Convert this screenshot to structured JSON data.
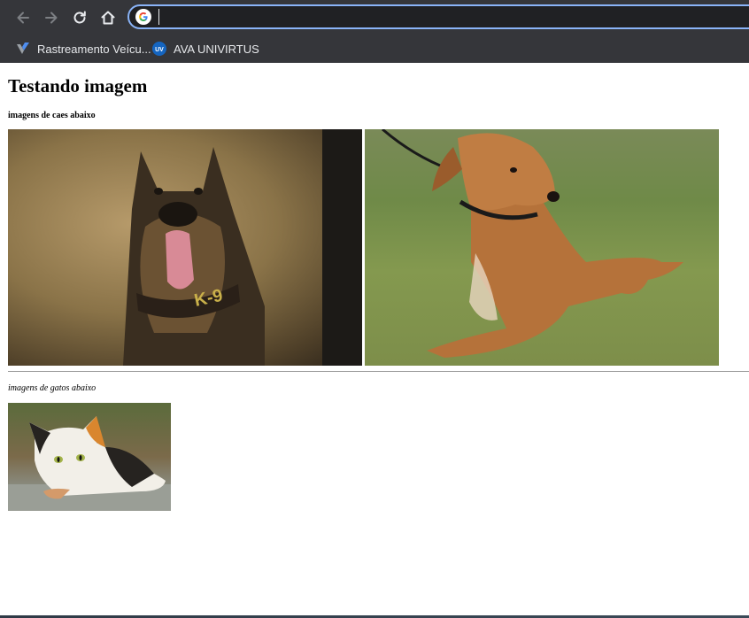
{
  "browser": {
    "address_value": "",
    "bookmarks": [
      {
        "label": "Rastreamento Veícu..."
      },
      {
        "label": "AVA UNIVIRTUS"
      }
    ]
  },
  "page": {
    "heading": "Testando imagem",
    "dogs_caption": "imagens de caes abaixo",
    "cats_caption": "imagens de gatos abaixo"
  },
  "icons": {
    "back": "arrow-left-icon",
    "forward": "arrow-right-icon",
    "reload": "reload-icon",
    "home": "home-icon",
    "google": "google-icon"
  },
  "colors": {
    "chrome_bg": "#35363a",
    "omnibox_bg": "#202124",
    "omnibox_focus": "#8ab4f8"
  }
}
